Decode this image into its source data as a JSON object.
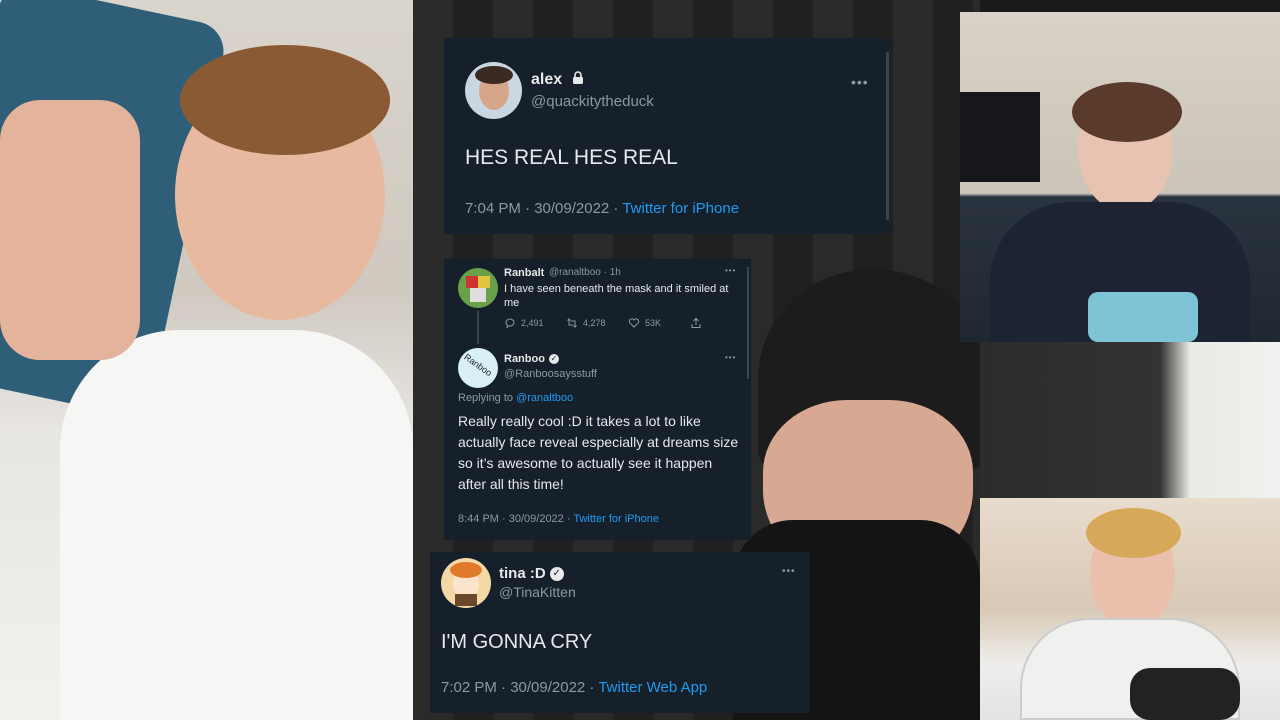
{
  "tweets": [
    {
      "name": "alex",
      "handle": "@quackitytheduck",
      "text": "HES REAL HES REAL",
      "time": "7:04 PM · 30/09/2022 · ",
      "source": "Twitter for iPhone"
    },
    {
      "quoted": {
        "name": "Ranbalt",
        "handle": "@ranaltboo · 1h",
        "text": "I have seen beneath the mask and it smiled at me",
        "replies": "2,491",
        "retweets": "4,278",
        "likes": "53K"
      },
      "avatar_text": "Ranboo",
      "name": "Ranboo",
      "handle": "@Ranboosaysstuff",
      "replying_prefix": "Replying to ",
      "replying_to": "@ranaltboo",
      "text": "Really really cool :D it takes a lot to like actually face reveal especially at dreams size so it’s awesome to actually see it happen after all this time!",
      "time": "8:44 PM · 30/09/2022 · ",
      "source": "Twitter for iPhone"
    },
    {
      "name": "tina :D",
      "handle": "@TinaKitten",
      "text": "I'M GONNA CRY",
      "time": "7:02 PM · 30/09/2022 · ",
      "source": "Twitter Web App"
    }
  ],
  "icons": {
    "more": "more-dots-icon",
    "lock": "lock-icon",
    "verified": "verified-badge-icon"
  },
  "colors": {
    "card_bg": "#15202b",
    "link": "#1d9bf0",
    "muted": "#8b98a5"
  }
}
